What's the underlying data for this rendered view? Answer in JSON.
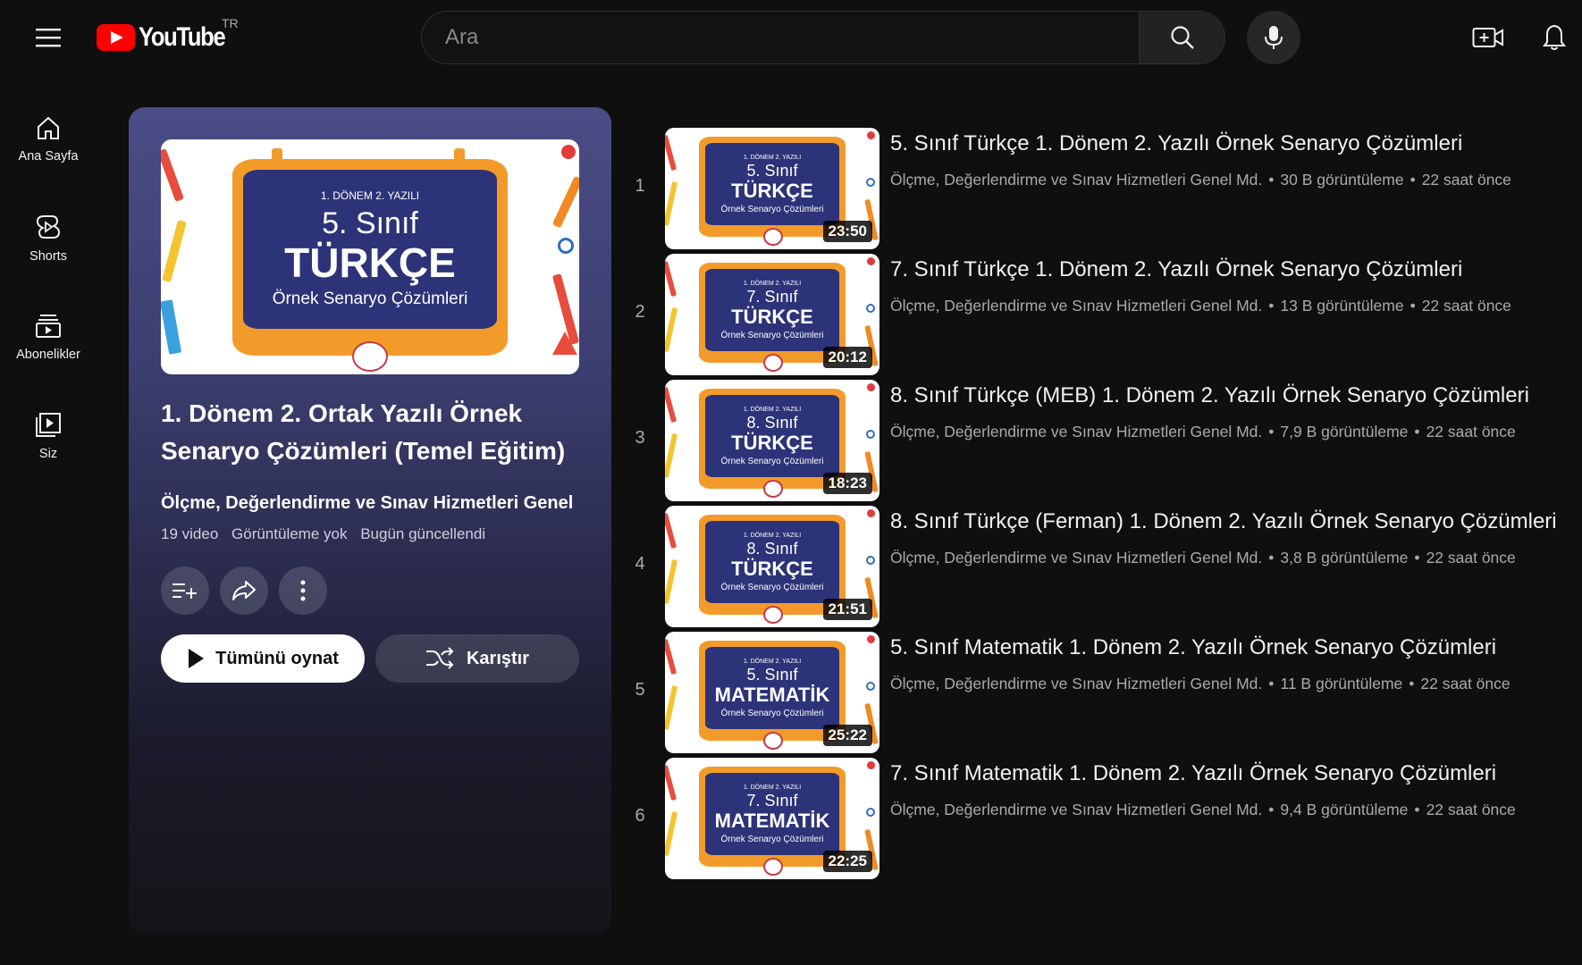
{
  "header": {
    "logo_text": "YouTube",
    "country_code": "TR",
    "search_placeholder": "Ara"
  },
  "sidebar": {
    "items": [
      {
        "label": "Ana Sayfa",
        "icon": "home-icon"
      },
      {
        "label": "Shorts",
        "icon": "shorts-icon"
      },
      {
        "label": "Abonelikler",
        "icon": "subscriptions-icon"
      },
      {
        "label": "Siz",
        "icon": "you-icon"
      }
    ]
  },
  "playlist": {
    "thumb": {
      "top": "1. DÖNEM 2. YAZILI",
      "grade": "5. Sınıf",
      "subject": "TÜRKÇE",
      "sub": "Örnek Senaryo Çözümleri"
    },
    "title": "1. Dönem 2. Ortak Yazılı Örnek Senaryo Çözümleri (Temel Eğitim)",
    "owner": "Ölçme, Değerlendirme ve Sınav Hizmetleri Genel",
    "video_count": "19 video",
    "views": "Görüntüleme yok",
    "updated": "Bugün güncellendi",
    "play_all_label": "Tümünü oynat",
    "shuffle_label": "Karıştır"
  },
  "videos": [
    {
      "index": "1",
      "title": "5. Sınıf Türkçe 1. Dönem 2. Yazılı Örnek Senaryo Çözümleri",
      "channel": "Ölçme, Değerlendirme ve Sınav Hizmetleri Genel Md.",
      "views": "30 B görüntüleme",
      "age": "22 saat önce",
      "duration": "23:50",
      "thumb": {
        "top": "1. DÖNEM 2. YAZILI",
        "grade": "5. Sınıf",
        "subject": "TÜRKÇE",
        "sub": "Örnek Senaryo Çözümleri"
      }
    },
    {
      "index": "2",
      "title": "7. Sınıf Türkçe 1. Dönem 2. Yazılı Örnek Senaryo Çözümleri",
      "channel": "Ölçme, Değerlendirme ve Sınav Hizmetleri Genel Md.",
      "views": "13 B görüntüleme",
      "age": "22 saat önce",
      "duration": "20:12",
      "thumb": {
        "top": "1. DÖNEM 2. YAZILI",
        "grade": "7. Sınıf",
        "subject": "TÜRKÇE",
        "sub": "Örnek Senaryo Çözümleri"
      }
    },
    {
      "index": "3",
      "title": "8. Sınıf Türkçe (MEB) 1. Dönem 2. Yazılı Örnek Senaryo Çözümleri",
      "channel": "Ölçme, Değerlendirme ve Sınav Hizmetleri Genel Md.",
      "views": "7,9 B görüntüleme",
      "age": "22 saat önce",
      "duration": "18:23",
      "thumb": {
        "top": "1. DÖNEM 2. YAZILI",
        "grade": "8. Sınıf",
        "subject": "TÜRKÇE",
        "sub": "Örnek Senaryo Çözümleri"
      }
    },
    {
      "index": "4",
      "title": "8. Sınıf Türkçe (Ferman) 1. Dönem 2. Yazılı Örnek Senaryo Çözümleri",
      "channel": "Ölçme, Değerlendirme ve Sınav Hizmetleri Genel Md.",
      "views": "3,8 B görüntüleme",
      "age": "22 saat önce",
      "duration": "21:51",
      "thumb": {
        "top": "1. DÖNEM 2. YAZILI",
        "grade": "8. Sınıf",
        "subject": "TÜRKÇE",
        "sub": "Örnek Senaryo Çözümleri"
      }
    },
    {
      "index": "5",
      "title": "5. Sınıf Matematik 1. Dönem 2. Yazılı Örnek Senaryo Çözümleri",
      "channel": "Ölçme, Değerlendirme ve Sınav Hizmetleri Genel Md.",
      "views": "11 B görüntüleme",
      "age": "22 saat önce",
      "duration": "25:22",
      "thumb": {
        "top": "1. DÖNEM 2. YAZILI",
        "grade": "5. Sınıf",
        "subject": "MATEMATİK",
        "sub": "Örnek Senaryo Çözümleri"
      }
    },
    {
      "index": "6",
      "title": "7. Sınıf Matematik 1. Dönem 2. Yazılı Örnek Senaryo Çözümleri",
      "channel": "Ölçme, Değerlendirme ve Sınav Hizmetleri Genel Md.",
      "views": "9,4 B görüntüleme",
      "age": "22 saat önce",
      "duration": "22:25",
      "thumb": {
        "top": "1. DÖNEM 2. YAZILI",
        "grade": "7. Sınıf",
        "subject": "MATEMATİK",
        "sub": "Örnek Senaryo Çözümleri"
      }
    }
  ],
  "colors": {
    "background": "#0f0f0f",
    "brand_red": "#ff0000",
    "board_orange": "#f39b2a",
    "board_navy": "#2d3378",
    "panel_top": "#4a4c85"
  }
}
